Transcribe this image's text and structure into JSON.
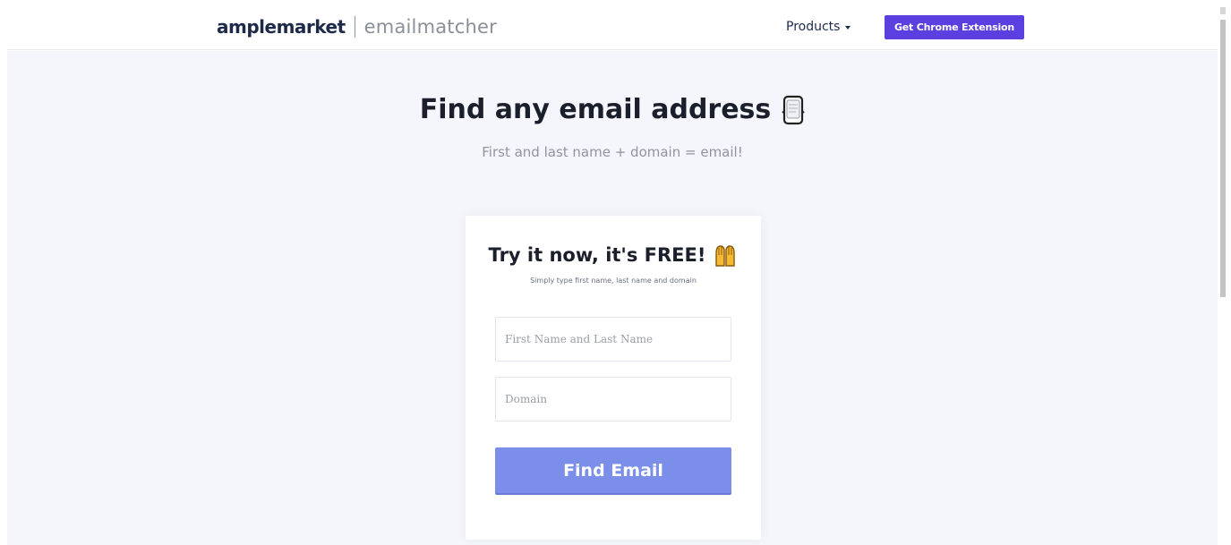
{
  "nav": {
    "brand": "amplemarket",
    "product": "emailmatcher",
    "products_label": "Products",
    "cta_label": "Get Chrome Extension"
  },
  "hero": {
    "title": "Find any email address",
    "title_icon": "envelope-icon",
    "subtitle": "First and last name + domain = email!"
  },
  "card": {
    "title": "Try it now, it's FREE!",
    "title_icon": "raising-hands-icon",
    "subtitle": "Simply type first name, last name and domain",
    "name_placeholder": "First Name and Last Name",
    "domain_placeholder": "Domain",
    "button_label": "Find Email"
  },
  "colors": {
    "brand_dark": "#1e2a4a",
    "cta_purple": "#5b3fe0",
    "button_blue": "#7b8eea",
    "page_bg": "#f4f6fb"
  }
}
